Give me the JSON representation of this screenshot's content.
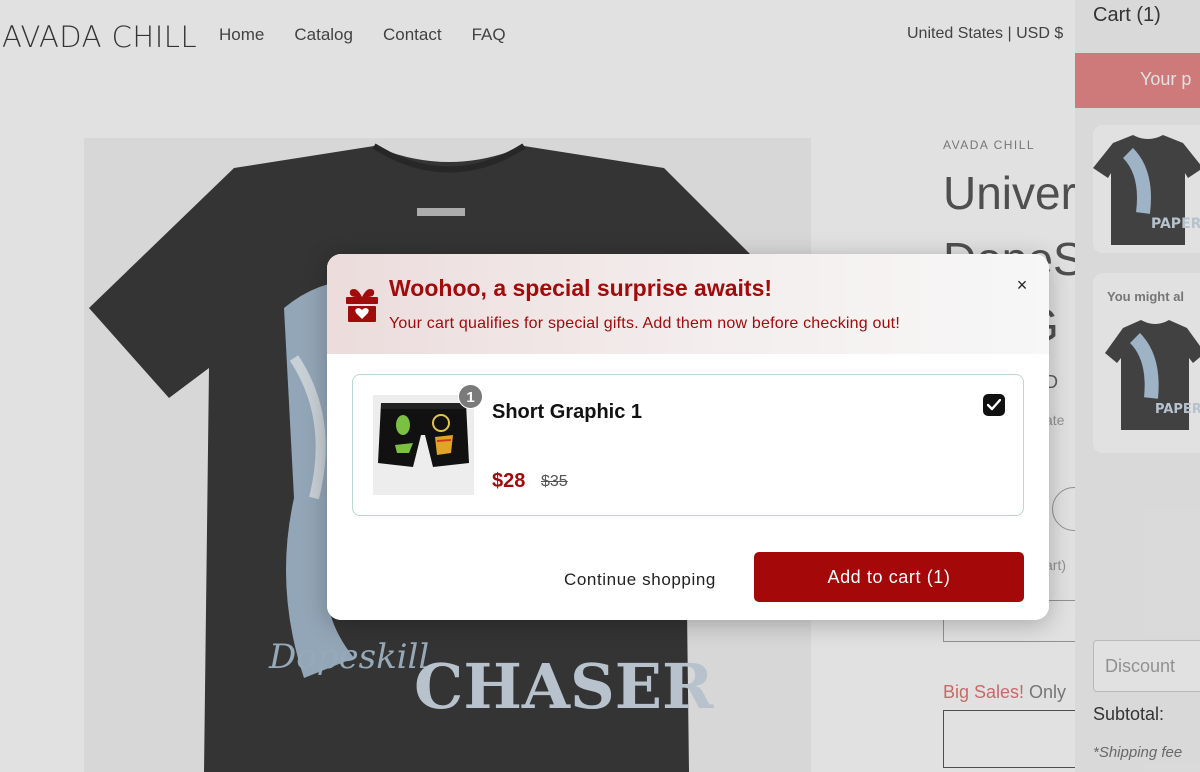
{
  "header": {
    "logo": "AVADA CHILL",
    "nav": [
      "Home",
      "Catalog",
      "Contact",
      "FAQ"
    ],
    "locale": "United States | USD $"
  },
  "product": {
    "vendor": "AVADA CHILL",
    "title_lines": [
      "Univer",
      "DopeS",
      "G"
    ],
    "price_fragment": "D",
    "tax_fragment": "ate",
    "cart_fragment": "art)",
    "big_sales_label": "Big Sales!",
    "big_sales_rest": " Only",
    "shirt_text": "CHASER"
  },
  "drawer": {
    "title": "Cart (1)",
    "banner": "Your p",
    "might_also": "You might al",
    "discount_placeholder": "Discount",
    "subtotal_label": "Subtotal:",
    "shipping_note": "*Shipping fee"
  },
  "modal": {
    "title": "Woohoo, a special surprise awaits!",
    "subtitle": "Your cart qualifies for special gifts. Add them now before checking out!",
    "close_symbol": "×",
    "item": {
      "name": "Short Graphic 1",
      "quantity_badge": "1",
      "price": "$28",
      "compare_price": "$35",
      "selected": true
    },
    "continue_label": "Continue shopping",
    "add_label": "Add to cart (1)"
  },
  "colors": {
    "accent": "#a50808",
    "overlay": "rgba(120,120,120,0.22)",
    "card_border": "#b9d8d2"
  }
}
